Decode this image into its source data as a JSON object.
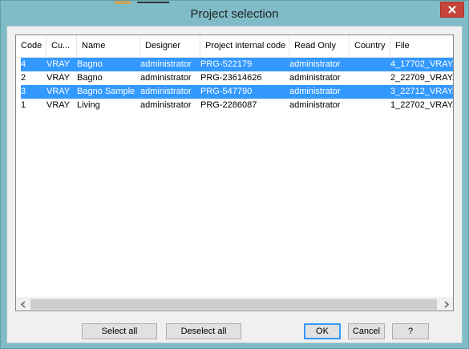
{
  "window": {
    "title": "Project selection",
    "colors": {
      "frame": "#7fbcc7",
      "close": "#c7443a",
      "selection": "#3399ff"
    }
  },
  "columns": [
    "Code",
    "Cu...",
    "Name",
    "Designer",
    "Project internal code",
    "Read Only",
    "Country",
    "File"
  ],
  "rows": [
    {
      "code": "4",
      "cu": "VRAY",
      "name": "Bagno",
      "designer": "administrator",
      "internal_code": "PRG-522179",
      "read_only": "administrator",
      "country": "",
      "file": "4_17702_VRAY.",
      "selected": true
    },
    {
      "code": "2",
      "cu": "VRAY",
      "name": "Bagno",
      "designer": "administrator",
      "internal_code": "PRG-23614626",
      "read_only": "administrator",
      "country": "",
      "file": "2_22709_VRAY.",
      "selected": false
    },
    {
      "code": "3",
      "cu": "VRAY",
      "name": "Bagno Sample",
      "designer": "administrator",
      "internal_code": "PRG-547790",
      "read_only": "administrator",
      "country": "",
      "file": "3_22712_VRAY.",
      "selected": true
    },
    {
      "code": "1",
      "cu": "VRAY",
      "name": "Living",
      "designer": "administrator",
      "internal_code": "PRG-2286087",
      "read_only": "administrator",
      "country": "",
      "file": "1_22702_VRAY.",
      "selected": false
    }
  ],
  "buttons": {
    "select_all": "Select all",
    "deselect_all": "Deselect all",
    "ok": "OK",
    "cancel": "Cancel",
    "help": "?"
  },
  "icons": {
    "close": "close-icon",
    "scroll_left": "chevron-left-icon",
    "scroll_right": "chevron-right-icon"
  }
}
